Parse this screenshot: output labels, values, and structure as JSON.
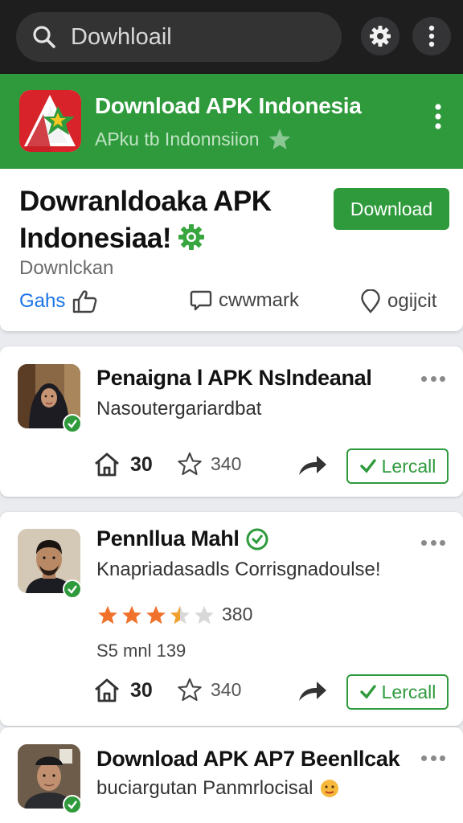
{
  "search": {
    "query": "Dowhloail"
  },
  "icons": {
    "search": "search-icon",
    "settings": "gear-icon",
    "more": "more-vertical-icon",
    "like": "thumbs-up-icon",
    "comment": "comment-icon",
    "pin": "location-pin-icon",
    "home": "home-icon",
    "star": "star-icon",
    "share": "share-arrow-icon",
    "check": "check-icon",
    "emoji": "emoji-icon"
  },
  "colors": {
    "brand_green": "#2f9a3c",
    "topbar": "#1e1e1e",
    "link_blue": "#1a73e8",
    "star_orange": "#f0712c"
  },
  "header": {
    "title": "Download APK Indonesia",
    "subtitle": "APku tb Indonnsiion"
  },
  "hero": {
    "title": "Dowranldoaka APK Indonesiaa!",
    "download_label": "Download",
    "subtitle": "Downlckan",
    "actions": {
      "gahs": "Gahs",
      "bookmark": "cwwmark",
      "location": "ogijcit"
    }
  },
  "posts": [
    {
      "name": "Penaigna l APK Nslndeanal",
      "description": "Nasoutergariardbat",
      "home_count": "30",
      "star_count": "340",
      "action_label": "Lercall"
    },
    {
      "name": "Pennllua Mahl",
      "description": "Knapriadasadls Corrisgnadoulse!",
      "rating": 3.5,
      "rating_count": "380",
      "meta": "S5 mnl 139",
      "home_count": "30",
      "star_count": "340",
      "action_label": "Lercall"
    },
    {
      "name": "Download APK AP7 Beenllcak",
      "description": "buciargutan Panmrlocisal"
    }
  ]
}
